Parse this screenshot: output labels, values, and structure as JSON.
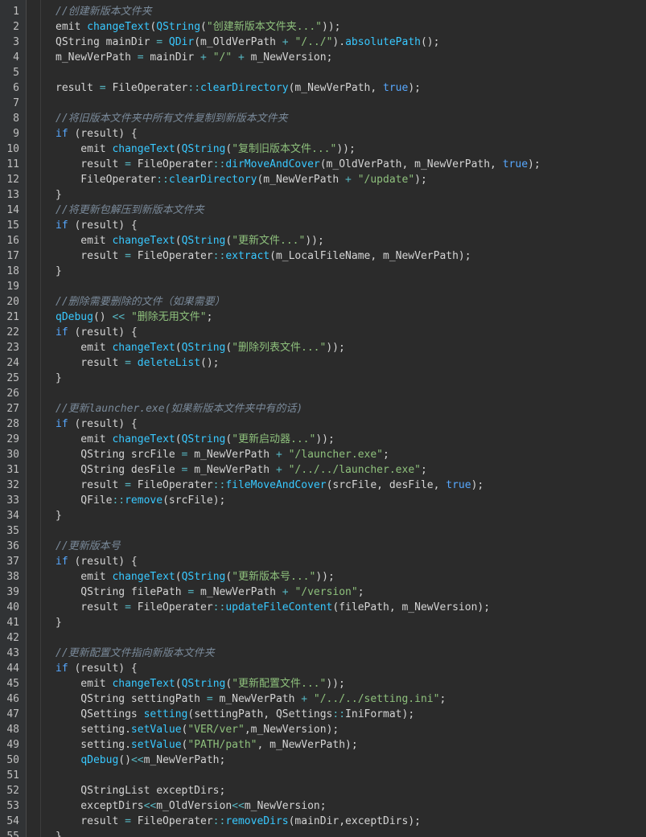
{
  "editor": {
    "lines": [
      {
        "n": "1",
        "t": [
          {
            "c": "cm",
            "s": "//创建新版本文件夹"
          }
        ]
      },
      {
        "n": "2",
        "t": [
          {
            "c": "txt",
            "s": "emit "
          },
          {
            "c": "fn",
            "s": "changeText"
          },
          {
            "c": "txt",
            "s": "("
          },
          {
            "c": "cls",
            "s": "QString"
          },
          {
            "c": "txt",
            "s": "("
          },
          {
            "c": "str",
            "s": "\"创建新版本文件夹...\""
          },
          {
            "c": "txt",
            "s": "));"
          }
        ]
      },
      {
        "n": "3",
        "t": [
          {
            "c": "txt",
            "s": "QString mainDir "
          },
          {
            "c": "op",
            "s": "="
          },
          {
            "c": "txt",
            "s": " "
          },
          {
            "c": "cls",
            "s": "QDir"
          },
          {
            "c": "txt",
            "s": "(m_OldVerPath "
          },
          {
            "c": "op",
            "s": "+"
          },
          {
            "c": "txt",
            "s": " "
          },
          {
            "c": "str",
            "s": "\"/../\""
          },
          {
            "c": "txt",
            "s": ")."
          },
          {
            "c": "fn",
            "s": "absolutePath"
          },
          {
            "c": "txt",
            "s": "();"
          }
        ]
      },
      {
        "n": "4",
        "t": [
          {
            "c": "txt",
            "s": "m_NewVerPath "
          },
          {
            "c": "op",
            "s": "="
          },
          {
            "c": "txt",
            "s": " mainDir "
          },
          {
            "c": "op",
            "s": "+"
          },
          {
            "c": "txt",
            "s": " "
          },
          {
            "c": "str",
            "s": "\"/\""
          },
          {
            "c": "txt",
            "s": " "
          },
          {
            "c": "op",
            "s": "+"
          },
          {
            "c": "txt",
            "s": " m_NewVersion;"
          }
        ]
      },
      {
        "n": "5",
        "t": []
      },
      {
        "n": "6",
        "t": [
          {
            "c": "txt",
            "s": "result "
          },
          {
            "c": "op",
            "s": "="
          },
          {
            "c": "txt",
            "s": " FileOperater"
          },
          {
            "c": "op",
            "s": "::"
          },
          {
            "c": "fn",
            "s": "clearDirectory"
          },
          {
            "c": "txt",
            "s": "(m_NewVerPath, "
          },
          {
            "c": "kw",
            "s": "true"
          },
          {
            "c": "txt",
            "s": ");"
          }
        ]
      },
      {
        "n": "7",
        "t": []
      },
      {
        "n": "8",
        "t": [
          {
            "c": "cm",
            "s": "//将旧版本文件夹中所有文件复制到新版本文件夹"
          }
        ]
      },
      {
        "n": "9",
        "t": [
          {
            "c": "kw",
            "s": "if"
          },
          {
            "c": "txt",
            "s": " (result) {"
          }
        ]
      },
      {
        "n": "10",
        "t": [
          {
            "c": "txt",
            "s": "    emit "
          },
          {
            "c": "fn",
            "s": "changeText"
          },
          {
            "c": "txt",
            "s": "("
          },
          {
            "c": "cls",
            "s": "QString"
          },
          {
            "c": "txt",
            "s": "("
          },
          {
            "c": "str",
            "s": "\"复制旧版本文件...\""
          },
          {
            "c": "txt",
            "s": "));"
          }
        ]
      },
      {
        "n": "11",
        "t": [
          {
            "c": "txt",
            "s": "    result "
          },
          {
            "c": "op",
            "s": "="
          },
          {
            "c": "txt",
            "s": " FileOperater"
          },
          {
            "c": "op",
            "s": "::"
          },
          {
            "c": "fn",
            "s": "dirMoveAndCover"
          },
          {
            "c": "txt",
            "s": "(m_OldVerPath, m_NewVerPath, "
          },
          {
            "c": "kw",
            "s": "true"
          },
          {
            "c": "txt",
            "s": ");"
          }
        ]
      },
      {
        "n": "12",
        "t": [
          {
            "c": "txt",
            "s": "    FileOperater"
          },
          {
            "c": "op",
            "s": "::"
          },
          {
            "c": "fn",
            "s": "clearDirectory"
          },
          {
            "c": "txt",
            "s": "(m_NewVerPath "
          },
          {
            "c": "op",
            "s": "+"
          },
          {
            "c": "txt",
            "s": " "
          },
          {
            "c": "str",
            "s": "\"/update\""
          },
          {
            "c": "txt",
            "s": ");"
          }
        ]
      },
      {
        "n": "13",
        "t": [
          {
            "c": "txt",
            "s": "}"
          }
        ]
      },
      {
        "n": "14",
        "t": [
          {
            "c": "cm",
            "s": "//将更新包解压到新版本文件夹"
          }
        ]
      },
      {
        "n": "15",
        "t": [
          {
            "c": "kw",
            "s": "if"
          },
          {
            "c": "txt",
            "s": " (result) {"
          }
        ]
      },
      {
        "n": "16",
        "t": [
          {
            "c": "txt",
            "s": "    emit "
          },
          {
            "c": "fn",
            "s": "changeText"
          },
          {
            "c": "txt",
            "s": "("
          },
          {
            "c": "cls",
            "s": "QString"
          },
          {
            "c": "txt",
            "s": "("
          },
          {
            "c": "str",
            "s": "\"更新文件...\""
          },
          {
            "c": "txt",
            "s": "));"
          }
        ]
      },
      {
        "n": "17",
        "t": [
          {
            "c": "txt",
            "s": "    result "
          },
          {
            "c": "op",
            "s": "="
          },
          {
            "c": "txt",
            "s": " FileOperater"
          },
          {
            "c": "op",
            "s": "::"
          },
          {
            "c": "fn",
            "s": "extract"
          },
          {
            "c": "txt",
            "s": "(m_LocalFileName, m_NewVerPath);"
          }
        ]
      },
      {
        "n": "18",
        "t": [
          {
            "c": "txt",
            "s": "}"
          }
        ]
      },
      {
        "n": "19",
        "t": []
      },
      {
        "n": "20",
        "t": [
          {
            "c": "cm",
            "s": "//删除需要删除的文件（如果需要）"
          }
        ]
      },
      {
        "n": "21",
        "t": [
          {
            "c": "fn",
            "s": "qDebug"
          },
          {
            "c": "txt",
            "s": "() "
          },
          {
            "c": "op",
            "s": "<<"
          },
          {
            "c": "txt",
            "s": " "
          },
          {
            "c": "str",
            "s": "\"删除无用文件\""
          },
          {
            "c": "txt",
            "s": ";"
          }
        ]
      },
      {
        "n": "22",
        "t": [
          {
            "c": "kw",
            "s": "if"
          },
          {
            "c": "txt",
            "s": " (result) {"
          }
        ]
      },
      {
        "n": "23",
        "t": [
          {
            "c": "txt",
            "s": "    emit "
          },
          {
            "c": "fn",
            "s": "changeText"
          },
          {
            "c": "txt",
            "s": "("
          },
          {
            "c": "cls",
            "s": "QString"
          },
          {
            "c": "txt",
            "s": "("
          },
          {
            "c": "str",
            "s": "\"删除列表文件...\""
          },
          {
            "c": "txt",
            "s": "));"
          }
        ]
      },
      {
        "n": "24",
        "t": [
          {
            "c": "txt",
            "s": "    result "
          },
          {
            "c": "op",
            "s": "="
          },
          {
            "c": "txt",
            "s": " "
          },
          {
            "c": "fn",
            "s": "deleteList"
          },
          {
            "c": "txt",
            "s": "();"
          }
        ]
      },
      {
        "n": "25",
        "t": [
          {
            "c": "txt",
            "s": "}"
          }
        ]
      },
      {
        "n": "26",
        "t": []
      },
      {
        "n": "27",
        "t": [
          {
            "c": "cm",
            "s": "//更新launcher.exe(如果新版本文件夹中有的话)"
          }
        ]
      },
      {
        "n": "28",
        "t": [
          {
            "c": "kw",
            "s": "if"
          },
          {
            "c": "txt",
            "s": " (result) {"
          }
        ]
      },
      {
        "n": "29",
        "t": [
          {
            "c": "txt",
            "s": "    emit "
          },
          {
            "c": "fn",
            "s": "changeText"
          },
          {
            "c": "txt",
            "s": "("
          },
          {
            "c": "cls",
            "s": "QString"
          },
          {
            "c": "txt",
            "s": "("
          },
          {
            "c": "str",
            "s": "\"更新启动器...\""
          },
          {
            "c": "txt",
            "s": "));"
          }
        ]
      },
      {
        "n": "30",
        "t": [
          {
            "c": "txt",
            "s": "    QString srcFile "
          },
          {
            "c": "op",
            "s": "="
          },
          {
            "c": "txt",
            "s": " m_NewVerPath "
          },
          {
            "c": "op",
            "s": "+"
          },
          {
            "c": "txt",
            "s": " "
          },
          {
            "c": "str",
            "s": "\"/launcher.exe\""
          },
          {
            "c": "txt",
            "s": ";"
          }
        ]
      },
      {
        "n": "31",
        "t": [
          {
            "c": "txt",
            "s": "    QString desFile "
          },
          {
            "c": "op",
            "s": "="
          },
          {
            "c": "txt",
            "s": " m_NewVerPath "
          },
          {
            "c": "op",
            "s": "+"
          },
          {
            "c": "txt",
            "s": " "
          },
          {
            "c": "str",
            "s": "\"/../../launcher.exe\""
          },
          {
            "c": "txt",
            "s": ";"
          }
        ]
      },
      {
        "n": "32",
        "t": [
          {
            "c": "txt",
            "s": "    result "
          },
          {
            "c": "op",
            "s": "="
          },
          {
            "c": "txt",
            "s": " FileOperater"
          },
          {
            "c": "op",
            "s": "::"
          },
          {
            "c": "fn",
            "s": "fileMoveAndCover"
          },
          {
            "c": "txt",
            "s": "(srcFile, desFile, "
          },
          {
            "c": "kw",
            "s": "true"
          },
          {
            "c": "txt",
            "s": ");"
          }
        ]
      },
      {
        "n": "33",
        "t": [
          {
            "c": "txt",
            "s": "    QFile"
          },
          {
            "c": "op",
            "s": "::"
          },
          {
            "c": "fn",
            "s": "remove"
          },
          {
            "c": "txt",
            "s": "(srcFile);"
          }
        ]
      },
      {
        "n": "34",
        "t": [
          {
            "c": "txt",
            "s": "}"
          }
        ]
      },
      {
        "n": "35",
        "t": []
      },
      {
        "n": "36",
        "t": [
          {
            "c": "cm",
            "s": "//更新版本号"
          }
        ]
      },
      {
        "n": "37",
        "t": [
          {
            "c": "kw",
            "s": "if"
          },
          {
            "c": "txt",
            "s": " (result) {"
          }
        ]
      },
      {
        "n": "38",
        "t": [
          {
            "c": "txt",
            "s": "    emit "
          },
          {
            "c": "fn",
            "s": "changeText"
          },
          {
            "c": "txt",
            "s": "("
          },
          {
            "c": "cls",
            "s": "QString"
          },
          {
            "c": "txt",
            "s": "("
          },
          {
            "c": "str",
            "s": "\"更新版本号...\""
          },
          {
            "c": "txt",
            "s": "));"
          }
        ]
      },
      {
        "n": "39",
        "t": [
          {
            "c": "txt",
            "s": "    QString filePath "
          },
          {
            "c": "op",
            "s": "="
          },
          {
            "c": "txt",
            "s": " m_NewVerPath "
          },
          {
            "c": "op",
            "s": "+"
          },
          {
            "c": "txt",
            "s": " "
          },
          {
            "c": "str",
            "s": "\"/version\""
          },
          {
            "c": "txt",
            "s": ";"
          }
        ]
      },
      {
        "n": "40",
        "t": [
          {
            "c": "txt",
            "s": "    result "
          },
          {
            "c": "op",
            "s": "="
          },
          {
            "c": "txt",
            "s": " FileOperater"
          },
          {
            "c": "op",
            "s": "::"
          },
          {
            "c": "fn",
            "s": "updateFileContent"
          },
          {
            "c": "txt",
            "s": "(filePath, m_NewVersion);"
          }
        ]
      },
      {
        "n": "41",
        "t": [
          {
            "c": "txt",
            "s": "}"
          }
        ]
      },
      {
        "n": "42",
        "t": []
      },
      {
        "n": "43",
        "t": [
          {
            "c": "cm",
            "s": "//更新配置文件指向新版本文件夹"
          }
        ]
      },
      {
        "n": "44",
        "t": [
          {
            "c": "kw",
            "s": "if"
          },
          {
            "c": "txt",
            "s": " (result) {"
          }
        ]
      },
      {
        "n": "45",
        "t": [
          {
            "c": "txt",
            "s": "    emit "
          },
          {
            "c": "fn",
            "s": "changeText"
          },
          {
            "c": "txt",
            "s": "("
          },
          {
            "c": "cls",
            "s": "QString"
          },
          {
            "c": "txt",
            "s": "("
          },
          {
            "c": "str",
            "s": "\"更新配置文件...\""
          },
          {
            "c": "txt",
            "s": "));"
          }
        ]
      },
      {
        "n": "46",
        "t": [
          {
            "c": "txt",
            "s": "    QString settingPath "
          },
          {
            "c": "op",
            "s": "="
          },
          {
            "c": "txt",
            "s": " m_NewVerPath "
          },
          {
            "c": "op",
            "s": "+"
          },
          {
            "c": "txt",
            "s": " "
          },
          {
            "c": "str",
            "s": "\"/../../setting.ini\""
          },
          {
            "c": "txt",
            "s": ";"
          }
        ]
      },
      {
        "n": "47",
        "t": [
          {
            "c": "txt",
            "s": "    QSettings "
          },
          {
            "c": "fn",
            "s": "setting"
          },
          {
            "c": "txt",
            "s": "(settingPath, QSettings"
          },
          {
            "c": "op",
            "s": "::"
          },
          {
            "c": "txt",
            "s": "IniFormat);"
          }
        ]
      },
      {
        "n": "48",
        "t": [
          {
            "c": "txt",
            "s": "    setting."
          },
          {
            "c": "fn",
            "s": "setValue"
          },
          {
            "c": "txt",
            "s": "("
          },
          {
            "c": "str",
            "s": "\"VER/ver\""
          },
          {
            "c": "txt",
            "s": ",m_NewVersion);"
          }
        ]
      },
      {
        "n": "49",
        "t": [
          {
            "c": "txt",
            "s": "    setting."
          },
          {
            "c": "fn",
            "s": "setValue"
          },
          {
            "c": "txt",
            "s": "("
          },
          {
            "c": "str",
            "s": "\"PATH/path\""
          },
          {
            "c": "txt",
            "s": ", m_NewVerPath);"
          }
        ]
      },
      {
        "n": "50",
        "t": [
          {
            "c": "txt",
            "s": "    "
          },
          {
            "c": "fn",
            "s": "qDebug"
          },
          {
            "c": "txt",
            "s": "()"
          },
          {
            "c": "op",
            "s": "<<"
          },
          {
            "c": "txt",
            "s": "m_NewVerPath;"
          }
        ]
      },
      {
        "n": "51",
        "t": []
      },
      {
        "n": "52",
        "t": [
          {
            "c": "txt",
            "s": "    QStringList exceptDirs;"
          }
        ]
      },
      {
        "n": "53",
        "t": [
          {
            "c": "txt",
            "s": "    exceptDirs"
          },
          {
            "c": "op",
            "s": "<<"
          },
          {
            "c": "txt",
            "s": "m_OldVersion"
          },
          {
            "c": "op",
            "s": "<<"
          },
          {
            "c": "txt",
            "s": "m_NewVersion;"
          }
        ]
      },
      {
        "n": "54",
        "t": [
          {
            "c": "txt",
            "s": "    result "
          },
          {
            "c": "op",
            "s": "="
          },
          {
            "c": "txt",
            "s": " FileOperater"
          },
          {
            "c": "op",
            "s": "::"
          },
          {
            "c": "fn",
            "s": "removeDirs"
          },
          {
            "c": "txt",
            "s": "(mainDir,exceptDirs);"
          }
        ]
      },
      {
        "n": "55",
        "t": [
          {
            "c": "txt",
            "s": "}"
          }
        ]
      }
    ]
  }
}
